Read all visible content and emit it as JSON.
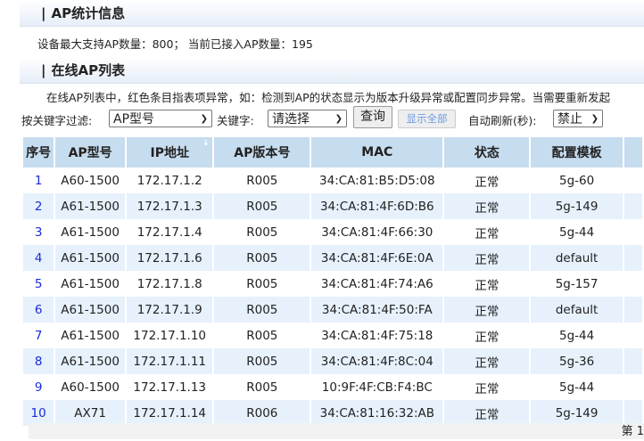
{
  "stats": {
    "title": "AP统计信息",
    "info": "设备最大支持AP数量：800； 当前已接入AP数量：195"
  },
  "list": {
    "title": "在线AP列表",
    "notice": "在线AP列表中，红色条目指表项异常，如：检测到AP的状态显示为版本升级异常或配置同步异常。当需要重新发起"
  },
  "filter": {
    "label": "按关键字过滤:",
    "field": "AP型号",
    "keyword_label": "关键字:",
    "keyword": "请选择",
    "query": "查询",
    "show_all": "显示全部",
    "refresh_label": "自动刷新(秒):",
    "refresh": "禁止"
  },
  "table": {
    "headers": [
      "序号",
      "AP型号",
      "IP地址",
      "AP版本号",
      "MAC",
      "状态",
      "配置模板"
    ],
    "rows": [
      [
        "1",
        "A60-1500",
        "172.17.1.2",
        "R005",
        "34:CA:81:B5:D5:08",
        "正常",
        "5g-60"
      ],
      [
        "2",
        "A61-1500",
        "172.17.1.3",
        "R005",
        "34:CA:81:4F:6D:B6",
        "正常",
        "5g-149"
      ],
      [
        "3",
        "A61-1500",
        "172.17.1.4",
        "R005",
        "34:CA:81:4F:66:30",
        "正常",
        "5g-44"
      ],
      [
        "4",
        "A61-1500",
        "172.17.1.6",
        "R005",
        "34:CA:81:4F:6E:0A",
        "正常",
        "default"
      ],
      [
        "5",
        "A61-1500",
        "172.17.1.8",
        "R005",
        "34:CA:81:4F:74:A6",
        "正常",
        "5g-157"
      ],
      [
        "6",
        "A61-1500",
        "172.17.1.9",
        "R005",
        "34:CA:81:4F:50:FA",
        "正常",
        "default"
      ],
      [
        "7",
        "A61-1500",
        "172.17.1.10",
        "R005",
        "34:CA:81:4F:75:18",
        "正常",
        "5g-44"
      ],
      [
        "8",
        "A61-1500",
        "172.17.1.11",
        "R005",
        "34:CA:81:4F:8C:04",
        "正常",
        "5g-36"
      ],
      [
        "9",
        "A60-1500",
        "172.17.1.13",
        "R005",
        "10:9F:4F:CB:F4:BC",
        "正常",
        "5g-44"
      ],
      [
        "10",
        "AX71",
        "172.17.1.14",
        "R006",
        "34:CA:81:16:32:AB",
        "正常",
        "5g-149"
      ]
    ]
  },
  "footer": {
    "page": "第 1"
  }
}
